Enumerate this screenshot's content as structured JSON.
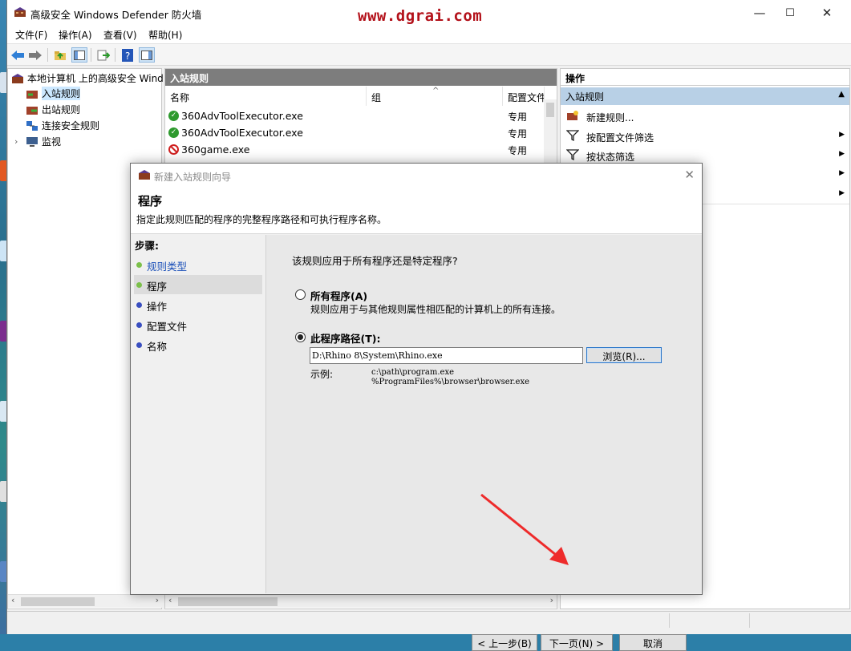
{
  "window": {
    "title": "高级安全 Windows Defender 防火墙",
    "watermark": "www.dgrai.com",
    "minimize": "—",
    "maximize": "☐",
    "close": "✕"
  },
  "menu": [
    "文件(F)",
    "操作(A)",
    "查看(V)",
    "帮助(H)"
  ],
  "tree": {
    "root": "本地计算机 上的高级安全 Wind",
    "items": [
      "入站规则",
      "出站规则",
      "连接安全规则",
      "监视"
    ]
  },
  "center": {
    "header": "入站规则",
    "columns": [
      "名称",
      "组",
      "配置文件"
    ],
    "rows": [
      {
        "name": "360AdvToolExecutor.exe",
        "profile": "专用",
        "status": "allow"
      },
      {
        "name": "360AdvToolExecutor.exe",
        "profile": "专用",
        "status": "allow"
      },
      {
        "name": "360game.exe",
        "profile": "专用",
        "status": "block"
      }
    ]
  },
  "actions": {
    "header": "操作",
    "group": "入站规则",
    "items": [
      "新建规则...",
      "按配置文件筛选",
      "按状态筛选"
    ]
  },
  "dialog": {
    "title": "新建入站规则向导",
    "heading": "程序",
    "subtitle": "指定此规则匹配的程序的完整程序路径和可执行程序名称。",
    "steps_caption": "步骤:",
    "steps": [
      {
        "label": "规则类型",
        "state": "done"
      },
      {
        "label": "程序",
        "state": "current"
      },
      {
        "label": "操作",
        "state": "pending"
      },
      {
        "label": "配置文件",
        "state": "pending"
      },
      {
        "label": "名称",
        "state": "pending"
      }
    ],
    "question": "该规则应用于所有程序还是特定程序?",
    "option_all": {
      "label": "所有程序(A)",
      "desc": "规则应用于与其他规则属性相匹配的计算机上的所有连接。",
      "selected": false
    },
    "option_path": {
      "label": "此程序路径(T):",
      "selected": true
    },
    "path_value": "D:\\Rhino 8\\System\\Rhino.exe",
    "browse_button": "浏览(R)...",
    "example_label": "示例:",
    "example_values": [
      "c:\\path\\program.exe",
      "%ProgramFiles%\\browser\\browser.exe"
    ],
    "back_button": "< 上一步(B)",
    "next_button": "下一页(N) >",
    "cancel_button": "取消"
  },
  "colors": {
    "watermark": "#b3111a",
    "selected_step_bg": "#dcdcdc",
    "done_step_dot": "#7cc04b",
    "pending_step_dot": "#3a4fc0",
    "annotation_arrow": "#ee2b2b",
    "actions_group_bg": "#b8d0e6"
  }
}
